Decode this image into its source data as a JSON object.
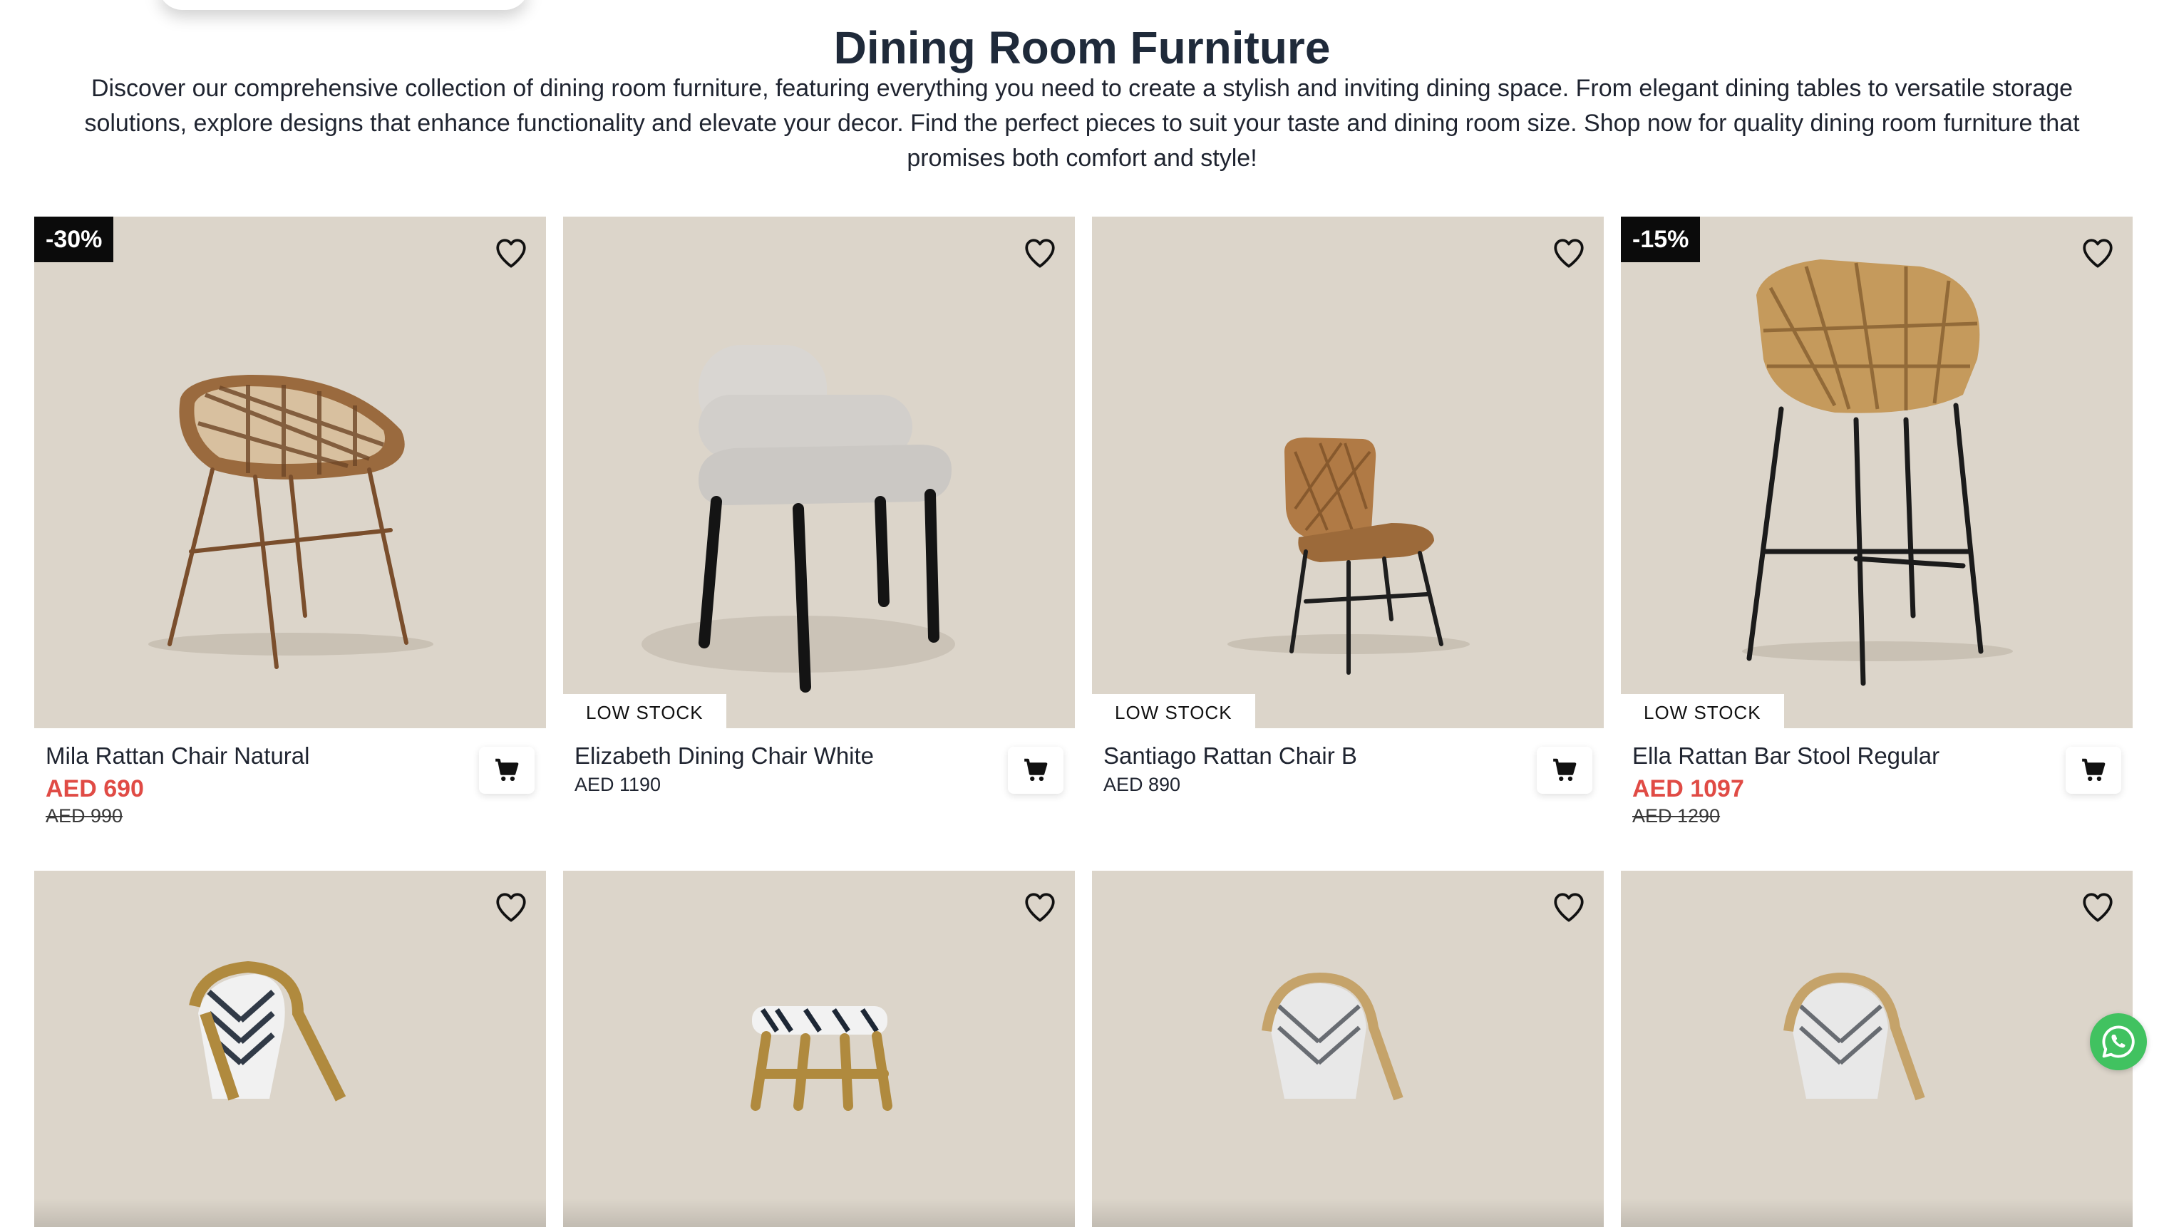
{
  "page": {
    "title": "Dining Room Furniture",
    "description": "Discover our comprehensive collection of dining room furniture, featuring everything you need to create a stylish and inviting dining space. From elegant dining tables to versatile storage solutions, explore designs that enhance functionality and elevate your decor. Find the perfect pieces to suit your taste and dining room size. Shop now for quality dining room furniture that promises both comfort and style!"
  },
  "colors": {
    "image_bg": "#dcd5ca",
    "sale_price": "#e04b45",
    "badge_bg": "#0b0b0b",
    "whatsapp": "#41c260"
  },
  "icons": [
    "heart-icon",
    "cart-icon",
    "whatsapp-icon"
  ],
  "products": [
    {
      "name": "Mila Rattan Chair Natural",
      "discount": "-30%",
      "sale_price": "AED 690",
      "old_price": "AED 990"
    },
    {
      "name": "Elizabeth Dining Chair White",
      "stock": "LOW STOCK",
      "price": "AED 1190"
    },
    {
      "name": "Santiago Rattan Chair B",
      "stock": "LOW STOCK",
      "price": "AED 890"
    },
    {
      "name": "Ella Rattan Bar Stool Regular",
      "discount": "-15%",
      "stock": "LOW STOCK",
      "sale_price": "AED 1097",
      "old_price": "AED 1290"
    }
  ]
}
